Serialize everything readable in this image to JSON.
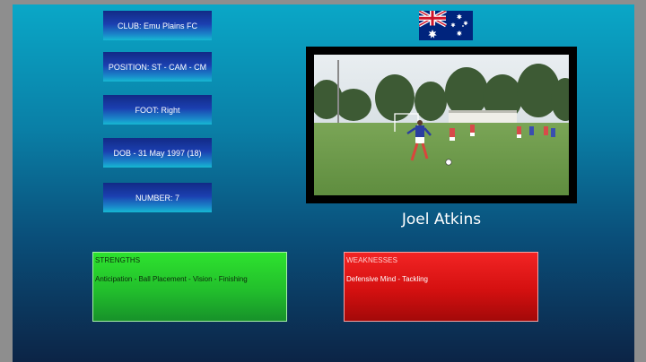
{
  "profile": {
    "club": "CLUB: Emu Plains FC",
    "position": "POSITION: ST - CAM - CM",
    "foot": "FOOT: Right",
    "dob": "DOB - 31 May 1997 (18)",
    "number": "NUMBER: 7"
  },
  "player_name": "Joel Atkins",
  "flag": {
    "country_icon": "australia-flag-icon",
    "blue": "#00247d",
    "red": "#cf142b"
  },
  "strengths": {
    "heading": "STRENGTHS",
    "text": "Anticipation - Ball Placement - Vision - Finishing",
    "color": "#22bf2c"
  },
  "weaknesses": {
    "heading": "WEAKNESSES",
    "text": "Defensive Mind - Tackling",
    "color": "#d41010"
  }
}
